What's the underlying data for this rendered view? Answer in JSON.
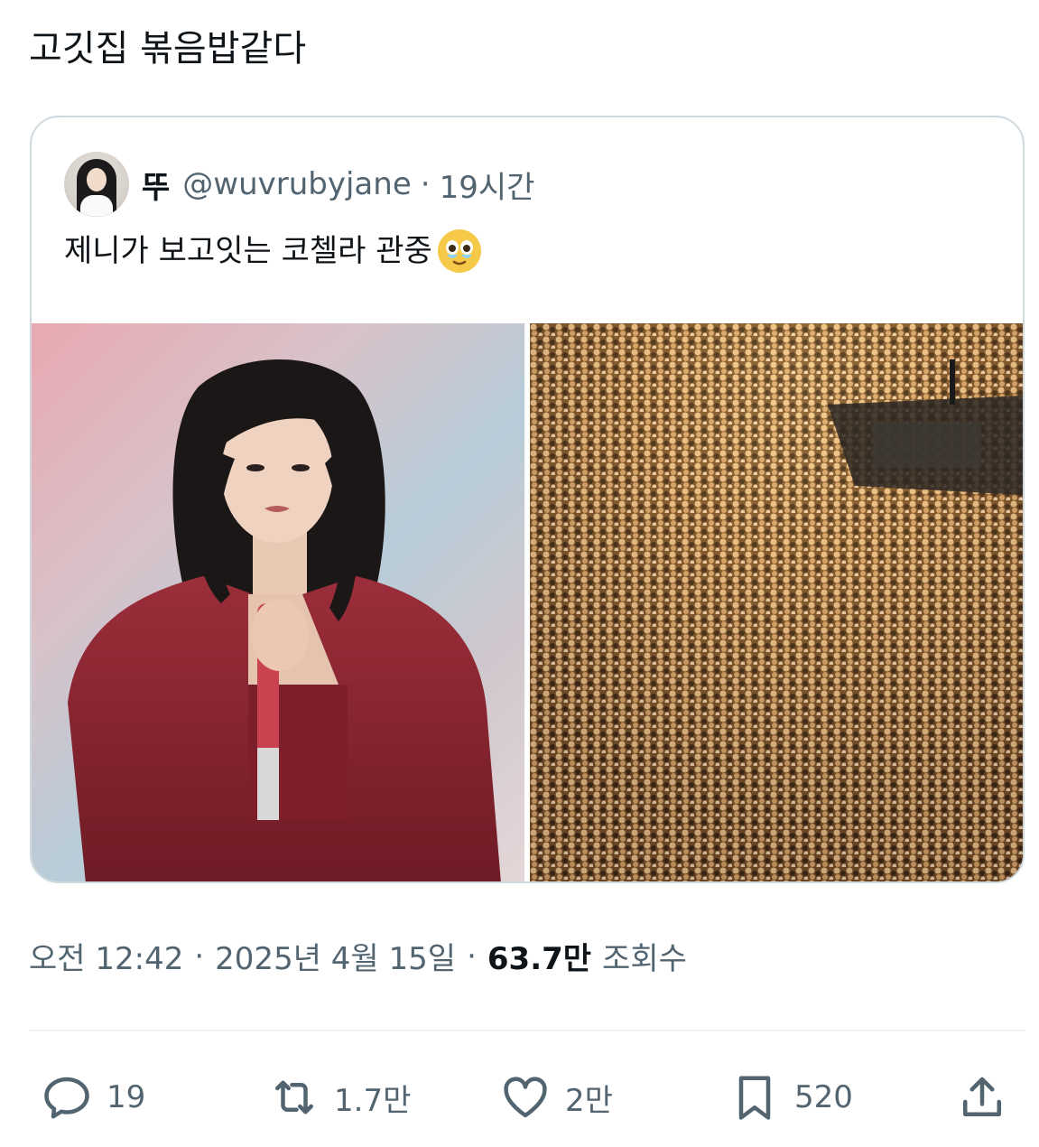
{
  "tweet": {
    "text": "고깃집 볶음밥같다"
  },
  "quoted": {
    "display_name": "뚜",
    "handle": "@wuvrubyjane",
    "age": "19시간",
    "text": "제니가 보고잇는 코첼라 관중",
    "emoji": "crying-face-emoji",
    "media": [
      {
        "name": "performer-photo"
      },
      {
        "name": "crowd-photo"
      }
    ]
  },
  "meta": {
    "time": "오전 12:42",
    "date": "2025년 4월 15일",
    "views_count": "63.7만",
    "views_label": "조회수"
  },
  "actions": {
    "reply_count": "19",
    "retweet_count": "1.7만",
    "like_count": "2만",
    "bookmark_count": "520"
  },
  "colors": {
    "primary_text": "#0f1419",
    "secondary_text": "#536471",
    "border": "#cfd9de"
  }
}
